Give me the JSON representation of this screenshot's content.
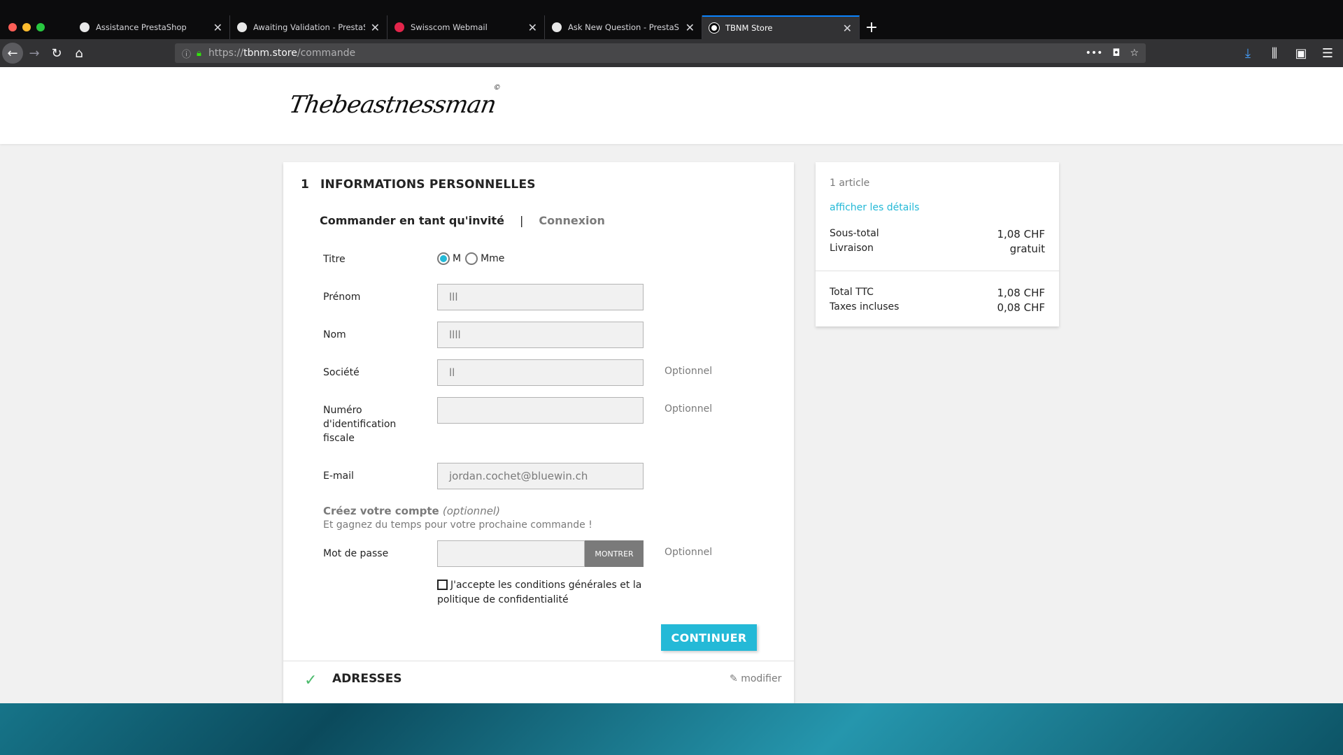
{
  "browser": {
    "tabs": [
      {
        "title": "Assistance PrestaShop",
        "favicon_color": "#e8e8e8"
      },
      {
        "title": "Awaiting Validation - PrestaSho",
        "favicon_color": "#e8e8e8"
      },
      {
        "title": "Swisscom Webmail",
        "favicon_color": "#e3254b"
      },
      {
        "title": "Ask New Question - PrestaSho",
        "favicon_color": "#e8e8e8"
      },
      {
        "title": "TBNM Store",
        "favicon_color": "#ffffff",
        "active": true
      }
    ],
    "new_tab_label": "+",
    "url": {
      "scheme": "https://",
      "host": "tbnm.store",
      "path": "/commande"
    },
    "icons": [
      "back-icon",
      "forward-icon",
      "reload-icon",
      "home-icon",
      "info-icon",
      "lock-icon",
      "more-icon",
      "pocket-icon",
      "bookmark-icon",
      "download-icon",
      "library-icon",
      "sidebar-icon",
      "menu-icon"
    ]
  },
  "site": {
    "logo_text": "Thebeastnessman",
    "logo_mark": "©"
  },
  "checkout": {
    "step_number": "1",
    "step_title": "INFORMATIONS PERSONNELLES",
    "guest_tab": "Commander en tant qu'invité",
    "separator": "|",
    "login_tab": "Connexion",
    "title_label": "Titre",
    "title_options": [
      "M",
      "Mme"
    ],
    "title_selected": "M",
    "firstname_label": "Prénom",
    "firstname_value": "lll",
    "lastname_label": "Nom",
    "lastname_value": "llll",
    "company_label": "Société",
    "company_value": "ll",
    "optional_text": "Optionnel",
    "vat_label_lines": [
      "Numéro",
      "d'identification",
      "fiscale"
    ],
    "vat_value": "",
    "email_label": "E-mail",
    "email_value": "jordan.cochet@bluewin.ch",
    "create_account_title": "Créez votre compte",
    "create_account_optional": "(optionnel)",
    "create_account_subtitle": "Et gagnez du temps pour votre prochaine commande !",
    "password_label": "Mot de passe",
    "show_button": "MONTRER",
    "terms_text": "J'accepte les conditions générales et la politique de confidentialité",
    "continue_button": "CONTINUER",
    "addresses_title": "ADRESSES",
    "modify_label": "modifier",
    "accent_color": "#24b9d7"
  },
  "summary": {
    "item_count": "1 article",
    "details_link": "afficher les détails",
    "subtotal_label": "Sous-total",
    "subtotal_value": "1,08 CHF",
    "shipping_label": "Livraison",
    "shipping_value": "gratuit",
    "total_label": "Total TTC",
    "total_value": "1,08 CHF",
    "taxes_label": "Taxes incluses",
    "taxes_value": "0,08 CHF"
  }
}
